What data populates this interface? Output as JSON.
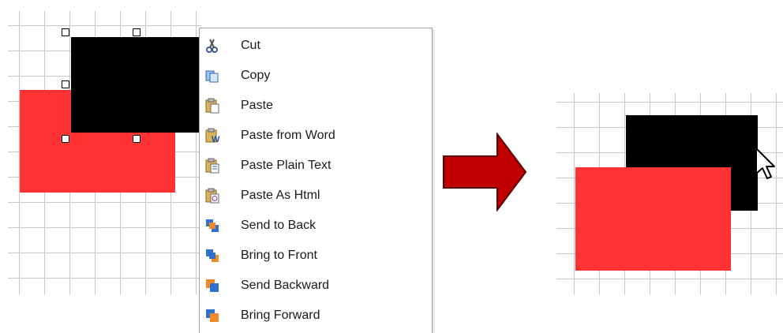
{
  "context_menu": {
    "items": [
      {
        "label": "Cut",
        "icon": "scissors-icon"
      },
      {
        "label": "Copy",
        "icon": "copy-icon"
      },
      {
        "label": "Paste",
        "icon": "paste-icon"
      },
      {
        "label": "Paste from Word",
        "icon": "paste-word-icon"
      },
      {
        "label": "Paste Plain Text",
        "icon": "paste-text-icon"
      },
      {
        "label": "Paste As Html",
        "icon": "paste-html-icon"
      },
      {
        "label": "Send to Back",
        "icon": "send-to-back-icon"
      },
      {
        "label": "Bring to Front",
        "icon": "bring-to-front-icon"
      },
      {
        "label": "Send Backward",
        "icon": "send-backward-icon"
      },
      {
        "label": "Bring Forward",
        "icon": "bring-forward-icon"
      }
    ]
  },
  "colors": {
    "red_shape": "#ff3333",
    "black_shape": "#000000",
    "arrow_fill": "#c00000",
    "grid_line": "#c8c8c8"
  }
}
